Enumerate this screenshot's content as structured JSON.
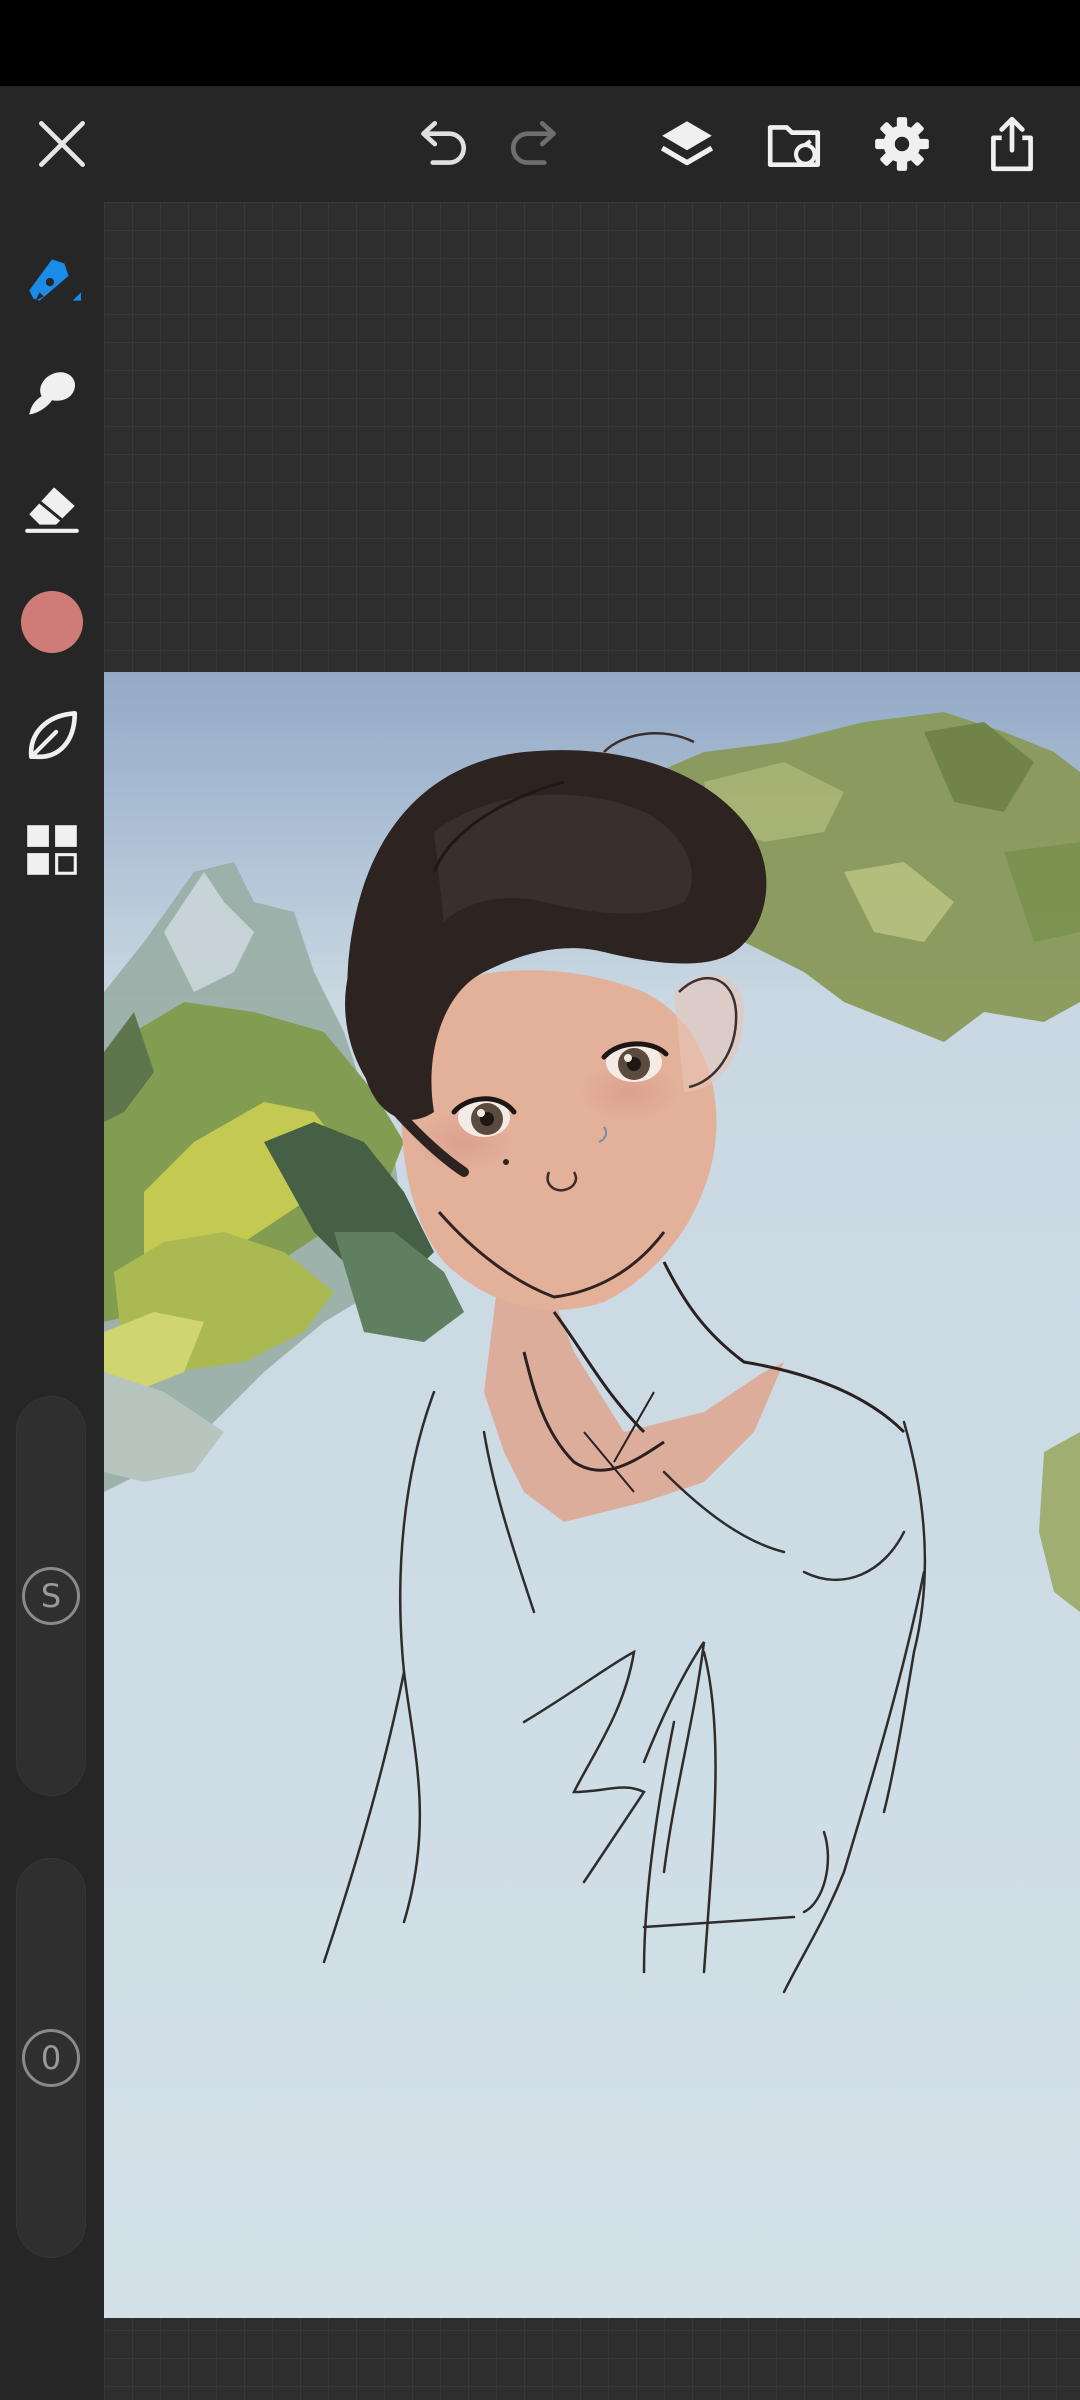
{
  "app": {
    "accent_color": "#1a8ce8",
    "toolbar_bg": "#262626",
    "canvas_bg": "#d0dee6"
  },
  "top_toolbar": {
    "buttons": [
      {
        "id": "close",
        "icon": "close-icon"
      },
      {
        "id": "undo",
        "icon": "undo-icon"
      },
      {
        "id": "redo",
        "icon": "redo-icon",
        "enabled": false
      },
      {
        "id": "layers",
        "icon": "layers-icon"
      },
      {
        "id": "gallery",
        "icon": "folder-sync-icon"
      },
      {
        "id": "settings",
        "icon": "gear-icon"
      },
      {
        "id": "share",
        "icon": "share-icon"
      }
    ]
  },
  "left_toolbar": {
    "tools": [
      {
        "id": "pen",
        "icon": "pen-icon",
        "active": true
      },
      {
        "id": "smudge",
        "icon": "smudge-icon"
      },
      {
        "id": "eraser",
        "icon": "eraser-icon"
      },
      {
        "id": "color",
        "icon": "color-swatch",
        "color": "#cf7b77"
      },
      {
        "id": "liquify",
        "icon": "leaf-icon"
      },
      {
        "id": "more",
        "icon": "grid-icon"
      }
    ],
    "size_slider": {
      "label": "S",
      "level": 0.5
    },
    "opacity_slider": {
      "label": "0",
      "level": 0.5
    }
  }
}
